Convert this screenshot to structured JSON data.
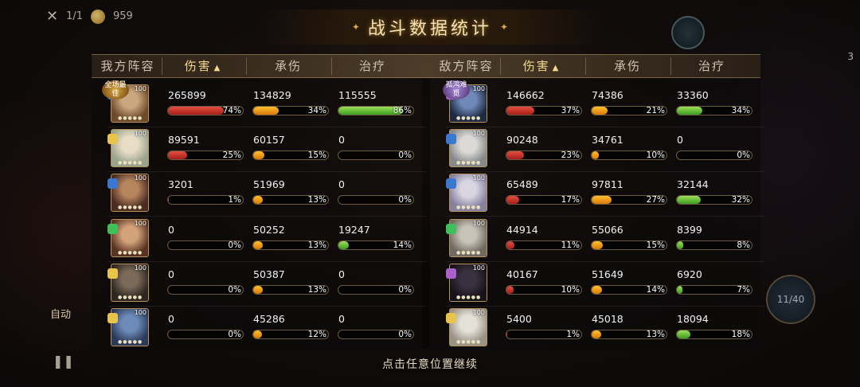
{
  "hud": {
    "icon": "close-icon",
    "wave": "1/1",
    "coins": "959",
    "coin_icon": "coin-icon"
  },
  "title": "战斗数据统计",
  "ally": {
    "team_label": "我方阵容",
    "headers": {
      "damage": "伤害",
      "taken": "承伤",
      "heal": "治疗"
    },
    "sort_icon": "▲",
    "mvp_badge": "全场最佳",
    "units": [
      {
        "level": "100",
        "damage": "265899",
        "damage_pct": "74%",
        "damage_fill": 0.74,
        "taken": "134829",
        "taken_pct": "34%",
        "taken_fill": 0.34,
        "heal": "115555",
        "heal_pct": "86%",
        "heal_fill": 0.86
      },
      {
        "level": "100",
        "damage": "89591",
        "damage_pct": "25%",
        "damage_fill": 0.25,
        "taken": "60157",
        "taken_pct": "15%",
        "taken_fill": 0.15,
        "heal": "0",
        "heal_pct": "0%",
        "heal_fill": 0
      },
      {
        "level": "100",
        "damage": "3201",
        "damage_pct": "1%",
        "damage_fill": 0.01,
        "taken": "51969",
        "taken_pct": "13%",
        "taken_fill": 0.13,
        "heal": "0",
        "heal_pct": "0%",
        "heal_fill": 0
      },
      {
        "level": "100",
        "damage": "0",
        "damage_pct": "0%",
        "damage_fill": 0,
        "taken": "50252",
        "taken_pct": "13%",
        "taken_fill": 0.13,
        "heal": "19247",
        "heal_pct": "14%",
        "heal_fill": 0.14
      },
      {
        "level": "100",
        "damage": "0",
        "damage_pct": "0%",
        "damage_fill": 0,
        "taken": "50387",
        "taken_pct": "13%",
        "taken_fill": 0.13,
        "heal": "0",
        "heal_pct": "0%",
        "heal_fill": 0
      },
      {
        "level": "100",
        "damage": "0",
        "damage_pct": "0%",
        "damage_fill": 0,
        "taken": "45286",
        "taken_pct": "12%",
        "taken_fill": 0.12,
        "heal": "0",
        "heal_pct": "0%",
        "heal_fill": 0
      }
    ]
  },
  "enemy": {
    "team_label": "敌方阵容",
    "headers": {
      "damage": "伤害",
      "taken": "承伤",
      "heal": "治疗"
    },
    "sort_icon": "▲",
    "mvp_badge": "孤鸿难觅",
    "units": [
      {
        "level": "100",
        "damage": "146662",
        "damage_pct": "37%",
        "damage_fill": 0.37,
        "taken": "74386",
        "taken_pct": "21%",
        "taken_fill": 0.21,
        "heal": "33360",
        "heal_pct": "34%",
        "heal_fill": 0.34
      },
      {
        "level": "100",
        "damage": "90248",
        "damage_pct": "23%",
        "damage_fill": 0.23,
        "taken": "34761",
        "taken_pct": "10%",
        "taken_fill": 0.1,
        "heal": "0",
        "heal_pct": "0%",
        "heal_fill": 0
      },
      {
        "level": "100",
        "damage": "65489",
        "damage_pct": "17%",
        "damage_fill": 0.17,
        "taken": "97811",
        "taken_pct": "27%",
        "taken_fill": 0.27,
        "heal": "32144",
        "heal_pct": "32%",
        "heal_fill": 0.32
      },
      {
        "level": "100",
        "damage": "44914",
        "damage_pct": "11%",
        "damage_fill": 0.11,
        "taken": "55066",
        "taken_pct": "15%",
        "taken_fill": 0.15,
        "heal": "8399",
        "heal_pct": "8%",
        "heal_fill": 0.08
      },
      {
        "level": "100",
        "damage": "40167",
        "damage_pct": "10%",
        "damage_fill": 0.1,
        "taken": "51649",
        "taken_pct": "14%",
        "taken_fill": 0.14,
        "heal": "6920",
        "heal_pct": "7%",
        "heal_fill": 0.07
      },
      {
        "level": "100",
        "damage": "5400",
        "damage_pct": "1%",
        "damage_fill": 0.01,
        "taken": "45018",
        "taken_pct": "13%",
        "taken_fill": 0.13,
        "heal": "18094",
        "heal_pct": "18%",
        "heal_fill": 0.18
      }
    ]
  },
  "footer": {
    "continue_text": "点击任意位置继续",
    "auto_label": "自动",
    "pause_icon": "pause-icon"
  },
  "side": {
    "right_counter": "3",
    "orb_text": "11/40"
  },
  "colors": {
    "damage": "#c9271f",
    "taken": "#f09a12",
    "heal": "#63bf35",
    "title": "#f4e2b8"
  }
}
